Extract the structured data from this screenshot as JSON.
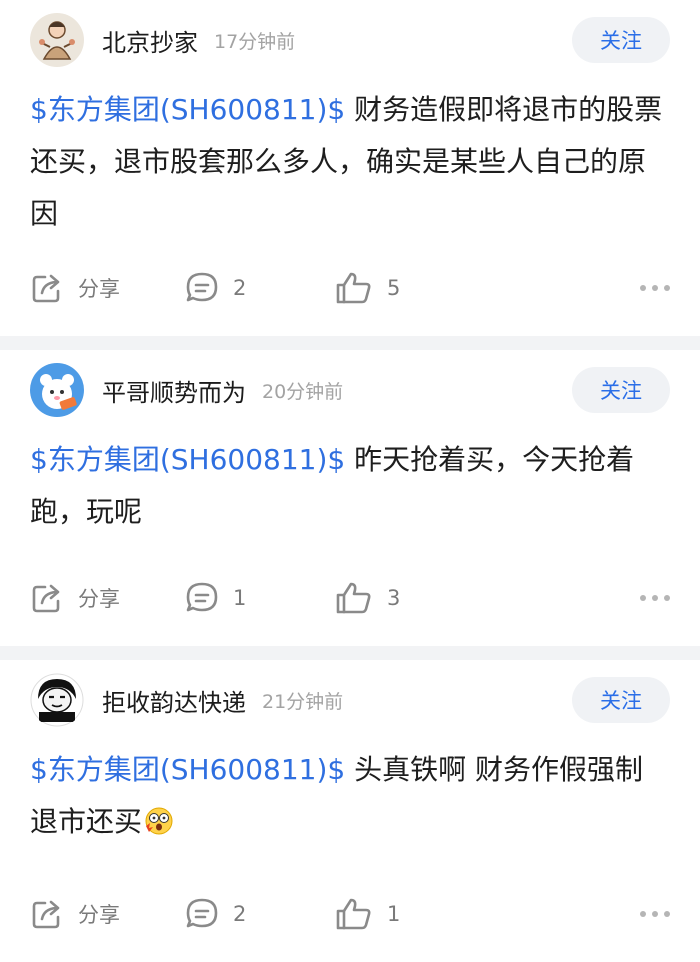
{
  "labels": {
    "follow": "关注",
    "share": "分享"
  },
  "posts": [
    {
      "author": "北京抄家",
      "time": "17分钟前",
      "stock": "$东方集团(SH600811)$",
      "text": " 财务造假即将退市的股票还买，退市股套那么多人，确实是某些人自己的原因",
      "comments": "2",
      "likes": "5",
      "avatar": "sketch-figure"
    },
    {
      "author": "平哥顺势而为",
      "time": "20分钟前",
      "stock": "$东方集团(SH600811)$",
      "text": " 昨天抢着买，今天抢着跑，玩呢",
      "comments": "1",
      "likes": "3",
      "avatar": "blue-cartoon"
    },
    {
      "author": "拒收韵达快递",
      "time": "21分钟前",
      "stock": "$东方集团(SH600811)$",
      "text": " 头真铁啊 财务作假强制退市还买",
      "emoji": "shocked-face-emoji",
      "comments": "2",
      "likes": "1",
      "avatar": "meme-face"
    }
  ],
  "colors": {
    "link": "#2f6fe0",
    "follow_bg": "#f0f2f5",
    "meta": "#a3a3a3",
    "icon": "#8a8a8a"
  }
}
